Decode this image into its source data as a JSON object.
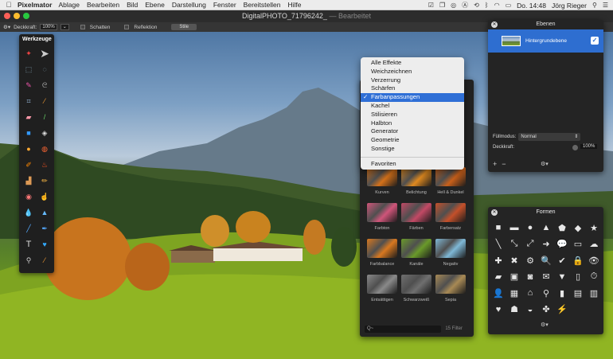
{
  "menubar": {
    "app_name": "Pixelmator",
    "items": [
      "Ablage",
      "Bearbeiten",
      "Bild",
      "Ebene",
      "Darstellung",
      "Fenster",
      "Bereitstellen",
      "Hilfe"
    ],
    "clock": "Do. 14:48",
    "user": "Jörg Rieger",
    "status_icons": [
      "checkbox-icon",
      "copy-icon",
      "broadcast-icon",
      "adobe-icon",
      "sync-icon",
      "bluetooth-icon",
      "wifi-icon",
      "battery-icon",
      "search-icon",
      "list-icon"
    ]
  },
  "window": {
    "title": "DigitalPHOTO_71796242_",
    "title_suffix": "— Bearbeitet"
  },
  "toolbar": {
    "opacity_label": "Deckkraft:",
    "opacity_value": "100%",
    "shadow_label": "Schatten",
    "reflection_label": "Reflektion",
    "styles_button": "Stile"
  },
  "tools_panel": {
    "title": "Werkzeuge",
    "tools": [
      "magic-wand-icon",
      "pointer-icon",
      "rect-select-icon",
      "ellipse-select-icon",
      "quick-select-icon",
      "lasso-icon",
      "crop-icon",
      "eyedropper-icon",
      "eraser-icon",
      "paintbrush-icon",
      "rect-shape-icon",
      "paint-bucket-icon",
      "ellipse-shape-icon",
      "gradient-icon",
      "brush-icon",
      "burn-icon",
      "stamp-icon",
      "pencil-icon",
      "red-eye-icon",
      "smudge-icon",
      "drop-icon",
      "sharpen-icon",
      "pen-icon",
      "freeform-pen-icon",
      "text-icon",
      "heart-shape-icon",
      "zoom-icon",
      "color-picker-icon"
    ]
  },
  "effects_menu": {
    "items": [
      "Alle Effekte",
      "Weichzeichnen",
      "Verzerrung",
      "Schärfen",
      "Farbanpassungen",
      "Kachel",
      "Stilisieren",
      "Halbton",
      "Generator",
      "Geometrie",
      "Sonstige"
    ],
    "selected": "Farbanpassungen",
    "favorites": "Favoriten"
  },
  "effects_browser": {
    "tiles": [
      {
        "label": "Kurven",
        "color": "#d4711a"
      },
      {
        "label": "Belichtung",
        "color": "#e08a20"
      },
      {
        "label": "Hell & Dunkel",
        "color": "#c9601a"
      },
      {
        "label": "Farbton",
        "color": "#d0557a"
      },
      {
        "label": "Färben",
        "color": "#c24965"
      },
      {
        "label": "Farbersatz",
        "color": "#c4502a"
      },
      {
        "label": "Farbbalance",
        "color": "#d87820"
      },
      {
        "label": "Kanäle",
        "color": "#6a9a2a"
      },
      {
        "label": "Negativ",
        "color": "#7fb8d6"
      },
      {
        "label": "Entsättigen",
        "color": "#8a8a8a"
      },
      {
        "label": "Schwarzweiß",
        "color": "#6f6f6f"
      },
      {
        "label": "Sepia",
        "color": "#a88a55"
      }
    ],
    "search_placeholder": "Q~",
    "count": "15 Filter"
  },
  "layers_panel": {
    "title": "Ebenen",
    "layer_name": "Hintergrundebene",
    "fill_mode_label": "Füllmodus:",
    "fill_mode_value": "Normal",
    "opacity_label": "Deckkraft:",
    "opacity_value": "100%",
    "add_label": "+",
    "remove_label": "−",
    "gear_label": "⚙▾"
  },
  "shapes_panel": {
    "title": "Formen",
    "shapes": [
      "■",
      "▬",
      "●",
      "▲",
      "⬟",
      "◆",
      "★",
      "╲",
      "⤡",
      "⤢",
      "➜",
      "💬",
      "▭",
      "☁",
      "✚",
      "✖",
      "⚙",
      "🔍",
      "✔",
      "🔒",
      "👁",
      "▰",
      "▣",
      "◙",
      "✉",
      "▼",
      "▯",
      "⏱",
      "👤",
      "▦",
      "⌂",
      "⚲",
      "▮",
      "▤",
      "▥",
      "♥",
      "☗",
      "◒",
      "✤",
      "⚡"
    ],
    "gear_label": "⚙▾"
  },
  "colors": {
    "selection_blue": "#2f6fd6",
    "layer_blue": "#2e6ed0",
    "panel_bg": "#242424"
  }
}
